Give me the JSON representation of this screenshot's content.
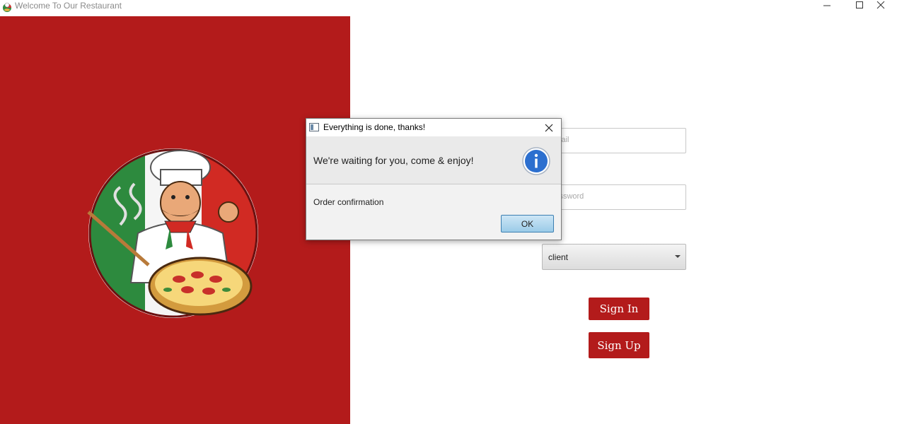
{
  "window": {
    "title": "Welcome To Our Restaurant",
    "controls": [
      "minimize-icon",
      "maximize-icon",
      "close-icon"
    ]
  },
  "colors": {
    "brand": "#b31b1b",
    "panel": "#b31b1b"
  },
  "login": {
    "email_placeholder": "Email",
    "password_placeholder": "Password",
    "role_value": "client",
    "sign_in_label": "Sign In",
    "sign_up_label": "Sign Up"
  },
  "dialog": {
    "title": "Everything is done, thanks!",
    "header": "We're waiting for you, come & enjoy!",
    "content": "Order confirmation",
    "ok_label": "OK",
    "icon": "info-icon"
  }
}
